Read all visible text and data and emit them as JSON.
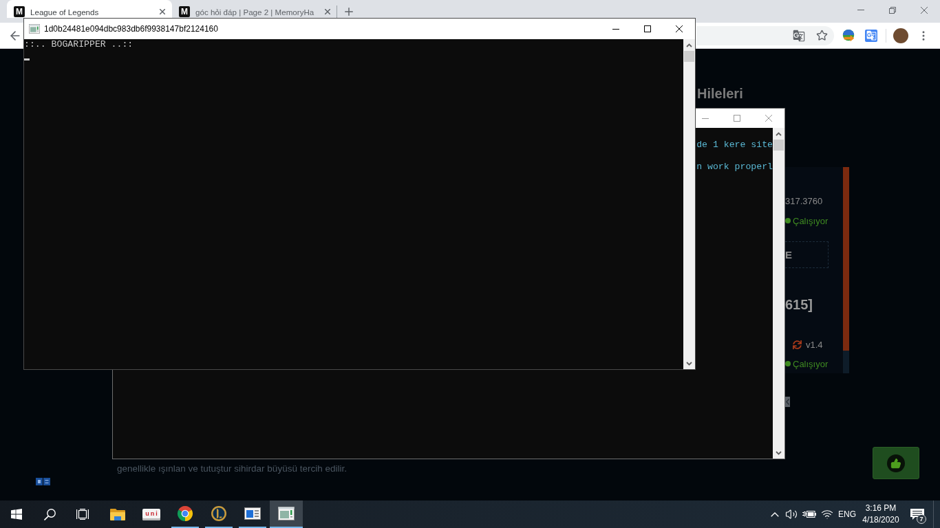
{
  "browser": {
    "tabs": [
      {
        "logo": "M",
        "title": "League of Legends",
        "selected": true
      },
      {
        "logo": "M",
        "title": "góc hỏi đáp | Page 2 | MemoryHa",
        "selected": false
      }
    ],
    "page": {
      "heading": "Hileleri",
      "panel": [
        {
          "kind": "text",
          "text": "317.3760"
        },
        {
          "kind": "status",
          "text": "Çalışıyor"
        },
        {
          "kind": "button",
          "text": "E"
        },
        {
          "kind": "title",
          "text": "615]"
        },
        {
          "kind": "version",
          "text": "v1.4"
        },
        {
          "kind": "status",
          "text": "Çalışıyor"
        }
      ],
      "paragraph": "genellikle ışınlan ve tutuştur sihirdar büyüsü tercih edilir."
    }
  },
  "console_windows": [
    {
      "title": "1d0b24481e094dbc983db6f9938147bf2124160",
      "active": true,
      "color": "#cccccc",
      "cursor": true,
      "lines": [
        "::.. BOGARIPPER ..::"
      ]
    },
    {
      "active": false,
      "color": "#5ab8d4",
      "lines": [
        "de 1 kere site",
        "n work properl"
      ]
    }
  ],
  "taskbar": {
    "apps": [
      {
        "kind": "folder",
        "running": false,
        "selected": false
      },
      {
        "kind": "keys",
        "label": "uni",
        "running": false,
        "selected": false
      },
      {
        "kind": "browser",
        "running": true,
        "selected": false
      },
      {
        "kind": "game",
        "running": true,
        "selected": false
      },
      {
        "kind": "window",
        "running": true,
        "selected": false
      },
      {
        "kind": "console",
        "running": true,
        "selected": true
      }
    ],
    "tray": {
      "language": "ENG",
      "time": "3:16 PM",
      "date": "4/18/2020",
      "notifications": "7"
    }
  }
}
